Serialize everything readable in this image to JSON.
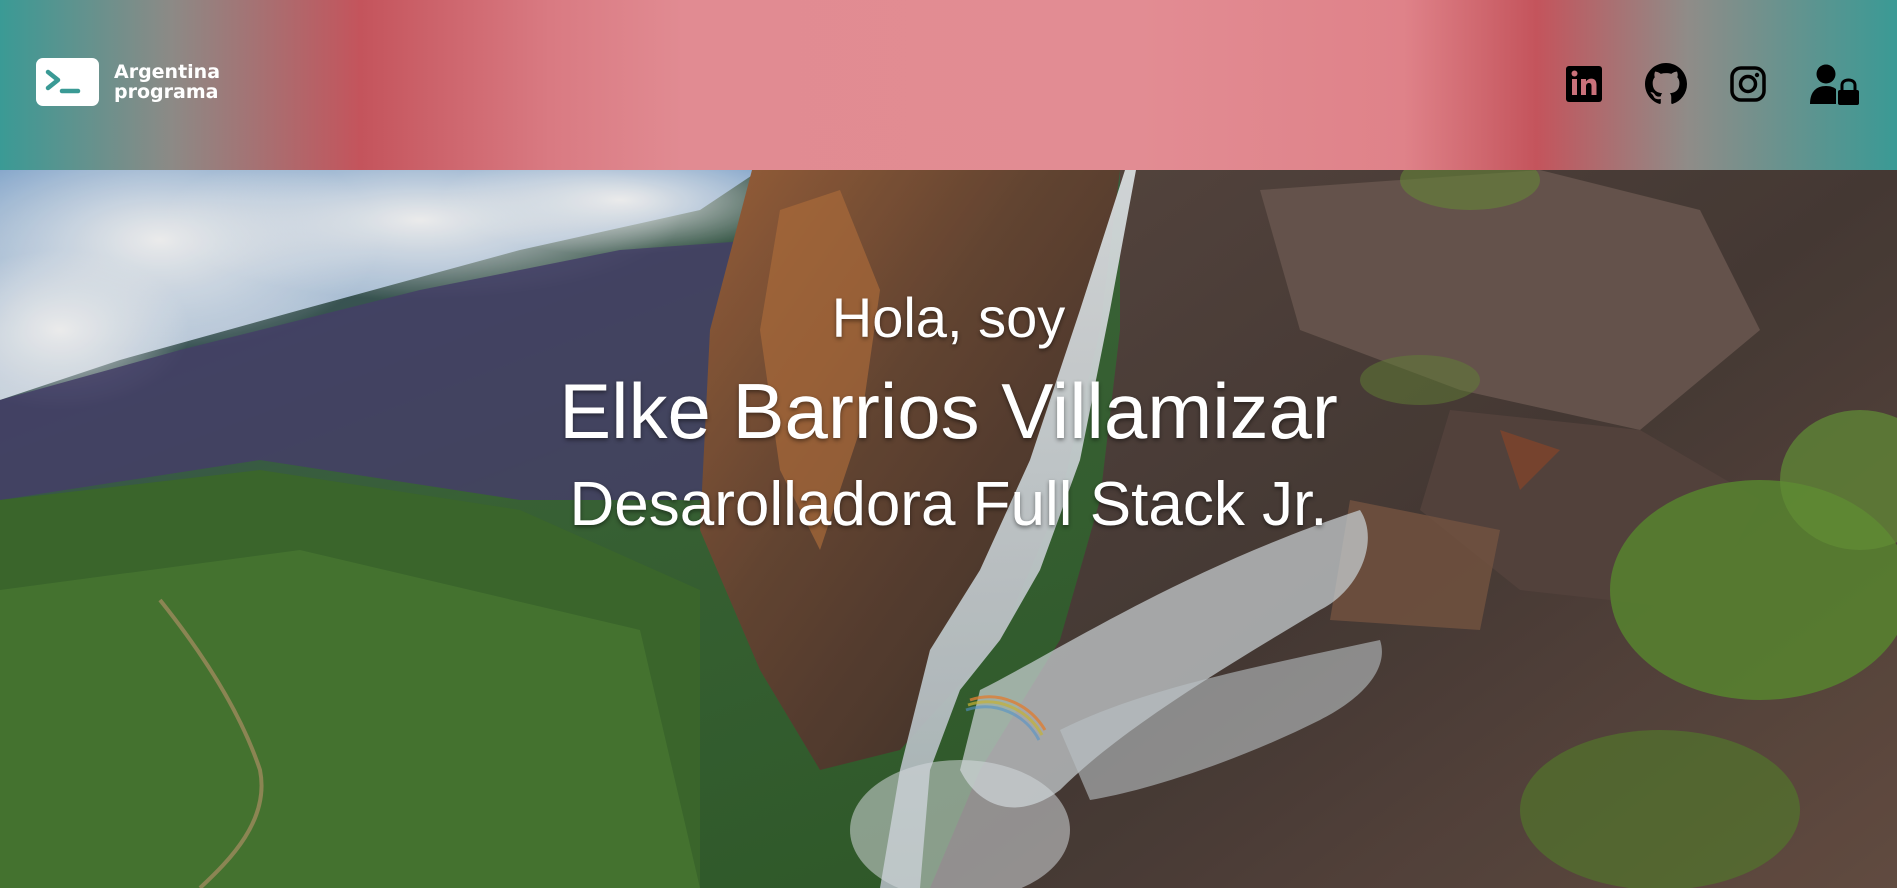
{
  "header": {
    "logo": {
      "line1": "Argentina",
      "line2": "programa",
      "icon": "terminal-prompt-icon"
    },
    "nav_icons": [
      "linkedin-icon",
      "github-icon",
      "instagram-icon",
      "user-lock-icon"
    ]
  },
  "hero": {
    "greeting": "Hola, soy",
    "name": "Elke Barrios Villamizar",
    "role": "Desarolladora Full Stack Jr.",
    "background": "aerial waterfall landscape photo"
  },
  "colors": {
    "header_teal": "#3a9a95",
    "header_red": "#c4545c",
    "header_pink": "#e28c93",
    "hero_text": "#ffffff",
    "icon_color": "#000000"
  }
}
